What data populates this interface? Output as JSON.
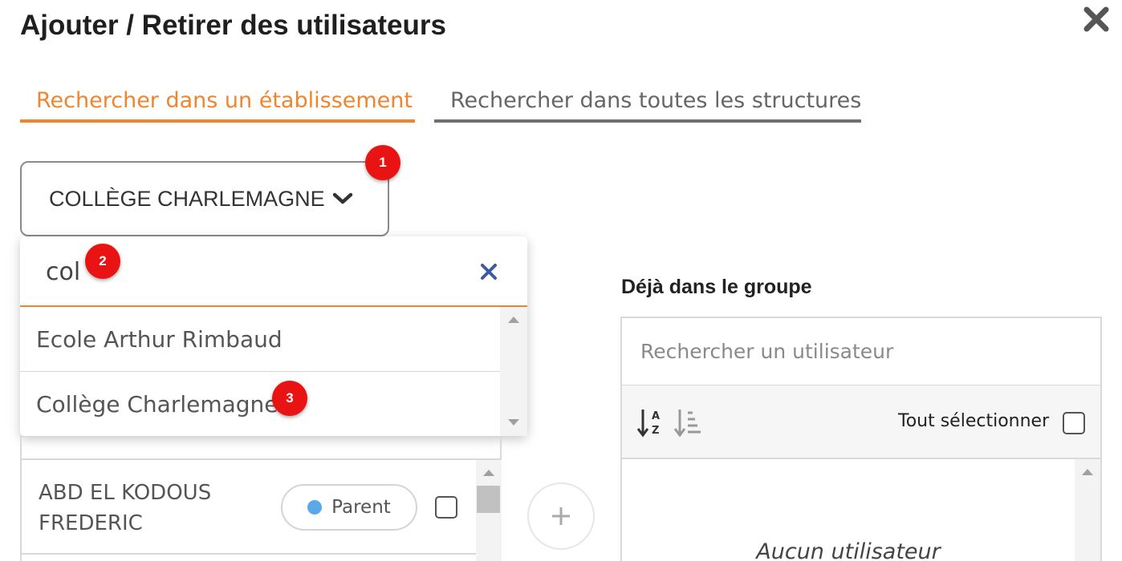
{
  "dialog": {
    "title": "Ajouter / Retirer des utilisateurs"
  },
  "tabs": [
    {
      "label": "Rechercher dans un établissement",
      "active": true
    },
    {
      "label": "Rechercher dans toutes les structures",
      "active": false
    }
  ],
  "structure_select": {
    "selected": "COLLÈGE CHARLEMAGNE"
  },
  "dropdown": {
    "search_value": "col",
    "options": [
      "Ecole Arthur Rimbaud",
      "Collège Charlemagne"
    ]
  },
  "badges": [
    "1",
    "2",
    "3"
  ],
  "users": [
    {
      "name": "ABD EL KODOUS FREDERIC",
      "role": "Parent",
      "role_color": "#5aa8e8"
    }
  ],
  "group": {
    "label": "Déjà dans le groupe",
    "search_placeholder": "Rechercher un utilisateur",
    "select_all_label": "Tout sélectionner",
    "empty_text": "Aucun utilisateur"
  },
  "colors": {
    "accent": "#f0852e",
    "badge": "#e81312",
    "clear_icon": "#3d5a9e"
  },
  "icons": [
    "close-icon",
    "chevron-down-icon",
    "clear-icon",
    "sort-alpha-icon",
    "sort-list-icon",
    "add-icon"
  ]
}
